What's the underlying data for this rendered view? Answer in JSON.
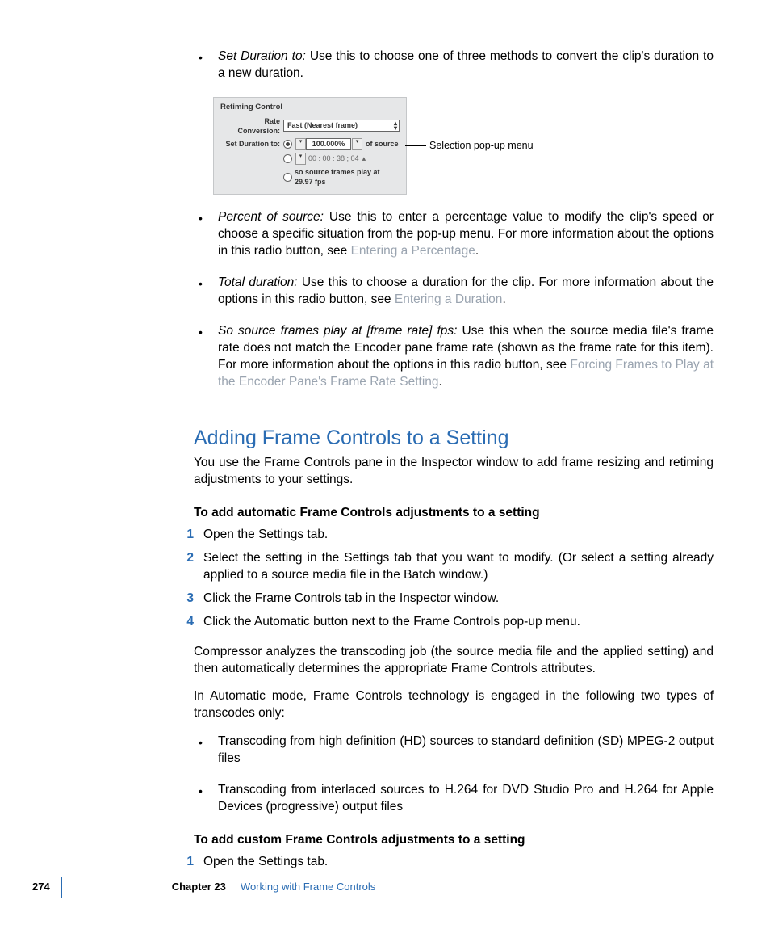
{
  "bullets1": {
    "set_duration": {
      "term": "Set Duration to:",
      "text": "  Use this to choose one of three methods to convert the clip's duration to a new duration."
    },
    "percent": {
      "term": "Percent of source:",
      "text_a": "  Use this to enter a percentage value to modify the clip's speed or choose a specific situation from the pop-up menu. For more information about the options in this radio button, see ",
      "link": "Entering a Percentage",
      "text_b": "."
    },
    "total": {
      "term": "Total duration:",
      "text_a": "  Use this to choose a duration for the clip. For more information about the options in this radio button, see ",
      "link": "Entering a Duration",
      "text_b": "."
    },
    "fps": {
      "term": "So source frames play at [frame rate] fps:",
      "text_a": "  Use this when the source media file's frame rate does not match the Encoder pane frame rate (shown as the frame rate for this item). For more information about the options in this radio button, see ",
      "link": "Forcing Frames to Play at the Encoder Pane's Frame Rate Setting",
      "text_b": "."
    }
  },
  "figure": {
    "panel_title": "Retiming  Control",
    "rate_label": "Rate Conversion:",
    "rate_value": "Fast (Nearest frame)",
    "dur_label": "Set Duration to:",
    "percent_value": "100.000%",
    "of_source": "of source",
    "timecode": "00 : 00 : 38 ; 04",
    "fps_line": "so source frames play at 29.97 fps",
    "callout": "Selection pop-up menu"
  },
  "heading": "Adding Frame Controls to a Setting",
  "intro": "You use the Frame Controls pane in the Inspector window to add frame resizing and retiming adjustments to your settings.",
  "sub1": "To add automatic Frame Controls adjustments to a setting",
  "steps1": {
    "s1": "Open the Settings tab.",
    "s2": "Select the setting in the Settings tab that you want to modify. (Or select a setting already applied to a source media file in the Batch window.)",
    "s3": "Click the Frame Controls tab in the Inspector window.",
    "s4": "Click the Automatic button next to the Frame Controls pop-up menu."
  },
  "para1": "Compressor analyzes the transcoding job (the source media file and the applied setting) and then automatically determines the appropriate Frame Controls attributes.",
  "para2": "In Automatic mode, Frame Controls technology is engaged in the following two types of transcodes only:",
  "bullets2": {
    "b1": "Transcoding from high definition (HD) sources to standard definition (SD) MPEG-2 output files",
    "b2": "Transcoding from interlaced sources to H.264 for DVD Studio Pro and H.264 for Apple Devices (progressive) output files"
  },
  "sub2": "To add custom Frame Controls adjustments to a setting",
  "steps2": {
    "s1": "Open the Settings tab."
  },
  "footer": {
    "page": "274",
    "chapter": "Chapter 23",
    "title": "Working with Frame Controls"
  }
}
